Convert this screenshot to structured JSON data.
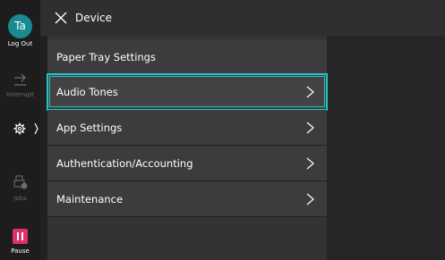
{
  "header": {
    "title": "Device"
  },
  "rail": {
    "user_initials": "Ta",
    "logout_label": "Log Out",
    "interrupt_label": "Interrupt",
    "jobs_label": "Jobs",
    "pause_label": "Pause"
  },
  "menu": {
    "items": [
      {
        "label": "Paper Tray Settings",
        "has_chevron": false
      },
      {
        "label": "Audio Tones",
        "has_chevron": true,
        "selected": true
      },
      {
        "label": "App Settings",
        "has_chevron": true
      },
      {
        "label": "Authentication/Accounting",
        "has_chevron": true
      },
      {
        "label": "Maintenance",
        "has_chevron": true
      }
    ]
  },
  "colors": {
    "accent": "#23c3c3",
    "avatar": "#1a8a92",
    "pause": "#e0306a"
  }
}
